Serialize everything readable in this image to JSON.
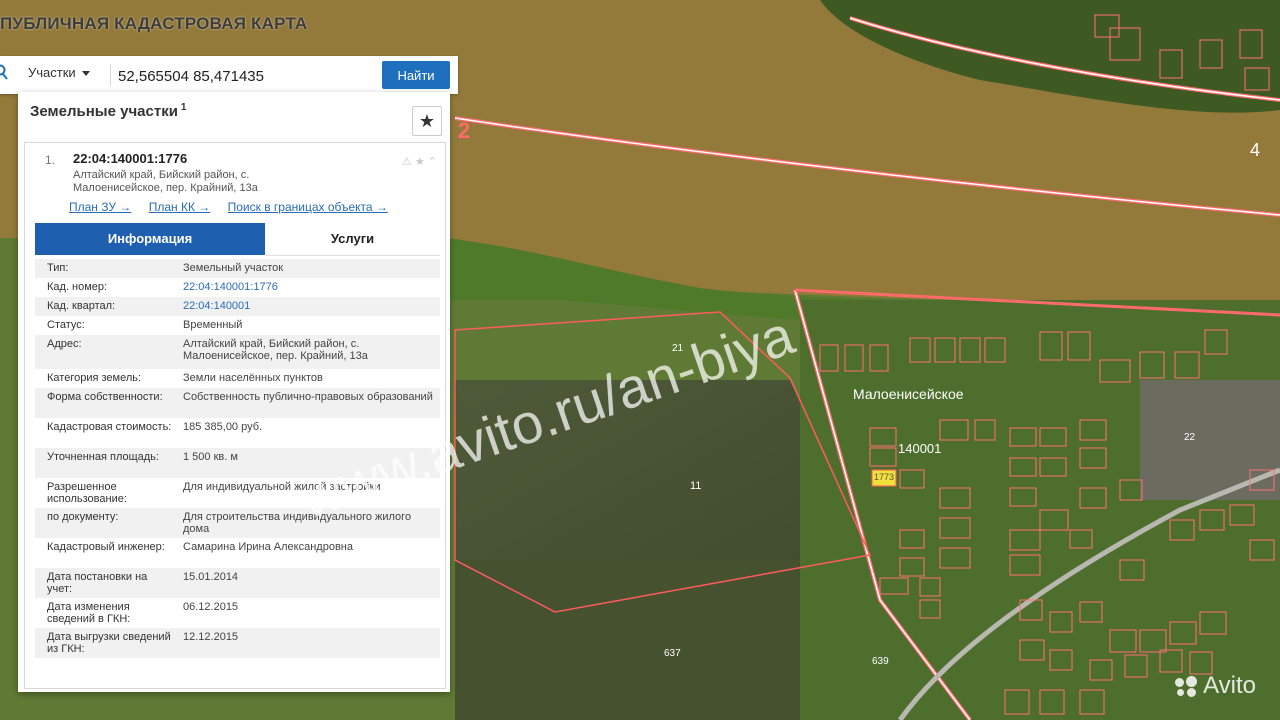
{
  "app": {
    "title": "ПУБЛИЧНАЯ КАДАСТРОВАЯ КАРТА"
  },
  "search": {
    "type_label": "Участки",
    "query": "52,565504 85,471435",
    "button_label": "Найти"
  },
  "panel": {
    "title": "Земельные участки",
    "title_sup": "1",
    "result": {
      "number": "1.",
      "cadastral_id": "22:04:140001:1776",
      "address_lines": [
        "Алтайский край, Бийский район, с.",
        "Малоенисейское, пер. Крайний, 13а"
      ],
      "links": [
        "План ЗУ →",
        "План КК →",
        "Поиск в границах объекта →"
      ],
      "tabs": [
        "Информация",
        "Услуги"
      ]
    },
    "info_rows": [
      {
        "k": "Тип:",
        "v": "Земельный участок"
      },
      {
        "k": "Кад. номер:",
        "v": "22:04:140001:1776",
        "link": true
      },
      {
        "k": "Кад. квартал:",
        "v": "22:04:140001",
        "link": true
      },
      {
        "k": "Статус:",
        "v": "Временный"
      },
      {
        "k": "Адрес:",
        "v": "Алтайский край, Бийский район, с. Малоенисейское, пер. Крайний, 13а"
      },
      {
        "k": "Категория земель:",
        "v": "Земли населённых пунктов"
      },
      {
        "k": "Форма собственности:",
        "v": "Собственность публично-правовых образований"
      },
      {
        "k": "Кадастровая стоимость:",
        "v": "185 385,00 руб."
      },
      {
        "k": "Уточненная площадь:",
        "v": "1 500 кв. м"
      },
      {
        "k": "Разрешенное использование:",
        "v": "Для индивидуальной жилой застройки"
      },
      {
        "k": "по документу:",
        "v": "Для строительства индивидуального жилого дома"
      },
      {
        "k": "Кадастровый инженер:",
        "v": "Самарина Ирина Александровна"
      },
      {
        "k": "Дата постановки на учет:",
        "v": "15.01.2014"
      },
      {
        "k": "Дата изменения сведений в ГКН:",
        "v": "06.12.2015"
      },
      {
        "k": "Дата выгрузки сведений из ГКН:",
        "v": "12.12.2015"
      }
    ]
  },
  "map": {
    "labels": {
      "village": "Малоенисейское",
      "quarter": "140001",
      "field": "11",
      "zone_2": "2",
      "zone_4": "4",
      "plot_21": "21",
      "plot_22": "22",
      "plot_637": "637",
      "plot_639": "639",
      "plot_1773": "1773"
    }
  },
  "watermark": {
    "text": "www.avito.ru/an-biya",
    "logo": "Avito"
  }
}
